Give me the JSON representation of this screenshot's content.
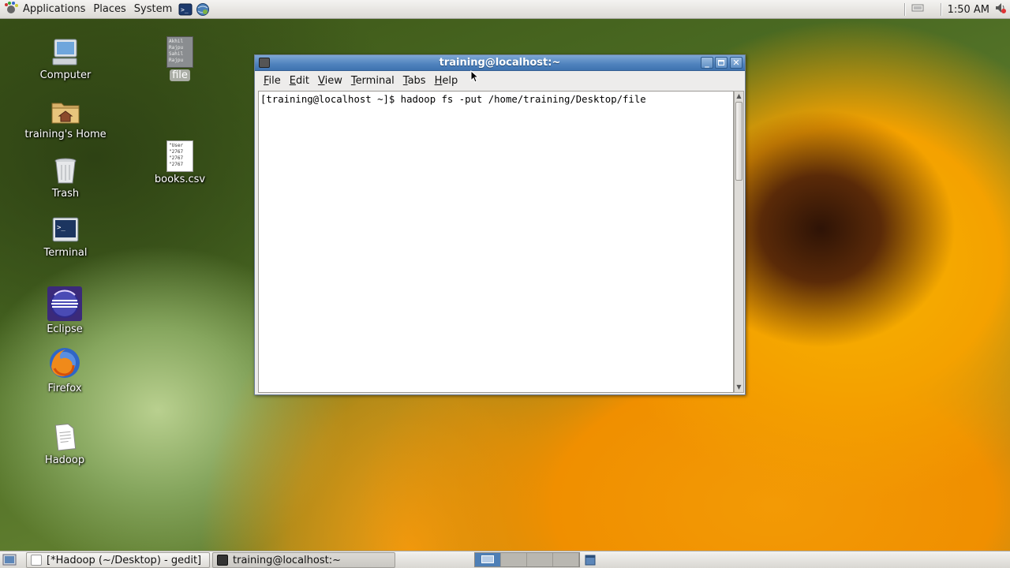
{
  "top_panel": {
    "menus": [
      "Applications",
      "Places",
      "System"
    ],
    "clock": "1:50 AM",
    "launchers": [
      "terminal-launcher-icon",
      "network-browser-icon"
    ]
  },
  "desktop_icons": [
    {
      "label": "Computer",
      "icon": "computer-icon"
    },
    {
      "label": "training's Home",
      "icon": "home-folder-icon"
    },
    {
      "label": "Trash",
      "icon": "trash-icon"
    },
    {
      "label": "Terminal",
      "icon": "terminal-icon"
    },
    {
      "label": "Eclipse",
      "icon": "eclipse-icon"
    },
    {
      "label": "Firefox",
      "icon": "firefox-icon"
    },
    {
      "label": "Hadoop",
      "icon": "text-file-icon"
    },
    {
      "label": "file",
      "icon": "text-file-icon",
      "preview_lines": [
        "Akhil",
        "Rajpu",
        "Sahil",
        "Rajpu"
      ]
    },
    {
      "label": "books.csv",
      "icon": "csv-file-icon",
      "preview_lines": [
        "\"User",
        "\"2767",
        "\"2767",
        "\"2767"
      ]
    }
  ],
  "terminal": {
    "title": "training@localhost:~",
    "menus": [
      {
        "label": "File",
        "mnemonic": "F",
        "rest": "ile"
      },
      {
        "label": "Edit",
        "mnemonic": "E",
        "rest": "dit"
      },
      {
        "label": "View",
        "mnemonic": "V",
        "rest": "iew"
      },
      {
        "label": "Terminal",
        "mnemonic": "T",
        "rest": "erminal"
      },
      {
        "label": "Tabs",
        "mnemonic": "T",
        "rest": "abs"
      },
      {
        "label": "Help",
        "mnemonic": "H",
        "rest": "elp"
      }
    ],
    "buffer_line": "[training@localhost ~]$ hadoop fs -put /home/training/Desktop/file"
  },
  "taskbar": {
    "tasks": [
      "[*Hadoop (~/Desktop) - gedit]",
      "training@localhost:~"
    ],
    "workspaces": 4,
    "active_workspace": 1
  }
}
